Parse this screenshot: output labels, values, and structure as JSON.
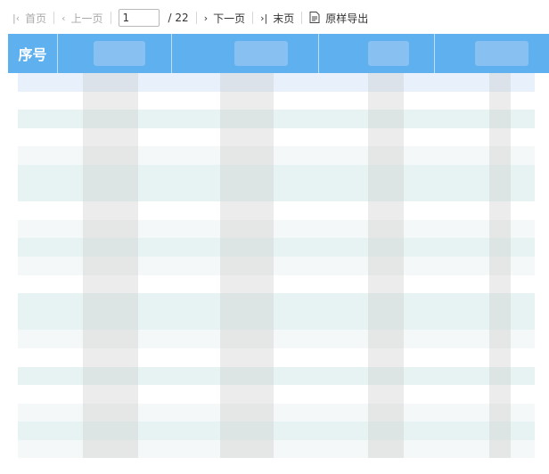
{
  "toolbar": {
    "first": "首页",
    "prev": "上一页",
    "page_value": "1",
    "total": "/ 22",
    "next": "下一页",
    "last": "末页",
    "export": "原样导出"
  },
  "table": {
    "header_first": "序号",
    "header_color": "#5fb0ee",
    "row_count": 21
  },
  "icons": {
    "first": "first-page-icon",
    "prev": "prev-page-icon",
    "next": "next-page-icon",
    "last": "last-page-icon",
    "export": "document-export-icon"
  }
}
